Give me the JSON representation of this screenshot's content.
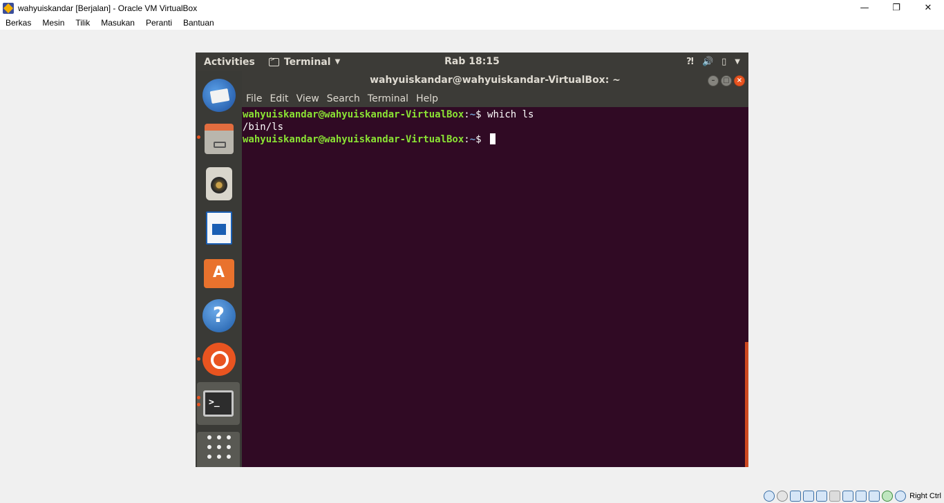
{
  "host": {
    "title": "wahyuiskandar [Berjalan] - Oracle VM VirtualBox",
    "controls": {
      "minimize": "—",
      "restore": "❐",
      "close": "✕"
    },
    "menu": [
      "Berkas",
      "Mesin",
      "Tilik",
      "Masukan",
      "Peranti",
      "Bantuan"
    ],
    "status": {
      "host_key": "Right Ctrl",
      "icons": [
        "hard-disk-icon",
        "optical-drive-icon",
        "audio-icon",
        "network-icon",
        "usb-icon",
        "shared-folders-icon",
        "display-icon",
        "video-capture-icon",
        "guest-additions-icon",
        "mouse-integration-icon",
        "cpu-icon"
      ]
    }
  },
  "guest": {
    "topbar": {
      "activities": "Activities",
      "app_menu": "Terminal",
      "clock": "Rab 18:15",
      "tray_icons": [
        "accessibility-icon",
        "volume-icon",
        "battery-icon",
        "system-menu-caret-icon"
      ]
    },
    "dock": {
      "items": [
        {
          "name": "thunderbird",
          "running": false
        },
        {
          "name": "files",
          "running": true
        },
        {
          "name": "rhythmbox",
          "running": false
        },
        {
          "name": "libreoffice-writer",
          "running": false
        },
        {
          "name": "ubuntu-software",
          "running": false
        },
        {
          "name": "help",
          "running": false
        },
        {
          "name": "ubuntu-amazon",
          "running": true
        },
        {
          "name": "terminal",
          "running": true,
          "active": true
        },
        {
          "name": "show-applications",
          "running": false
        }
      ],
      "terminal_glyph": ">_",
      "software_glyph": "A",
      "help_glyph": "?"
    },
    "terminal": {
      "title": "wahyuiskandar@wahyuiskandar-VirtualBox: ~",
      "menu": [
        "File",
        "Edit",
        "View",
        "Search",
        "Terminal",
        "Help"
      ],
      "lines": [
        {
          "user": "wahyuiskandar@wahyuiskandar-VirtualBox",
          "path": "~",
          "prompt": "$ ",
          "command": "which ls"
        },
        {
          "output": "/bin/ls"
        },
        {
          "user": "wahyuiskandar@wahyuiskandar-VirtualBox",
          "path": "~",
          "prompt": "$ ",
          "command": ""
        }
      ]
    }
  }
}
